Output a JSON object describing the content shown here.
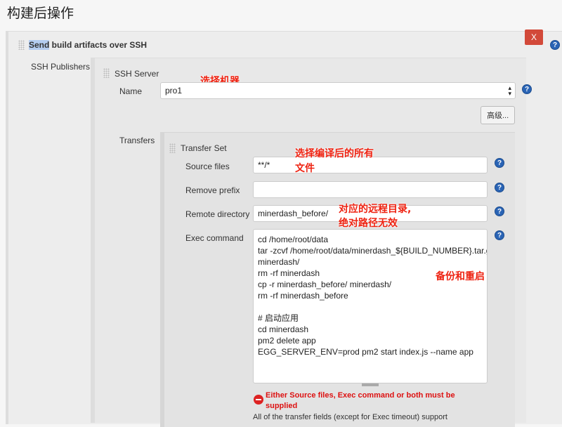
{
  "page_title": "构建后操作",
  "section": {
    "highlight": "Send",
    "title": " build artifacts over SSH",
    "delete_label": "X"
  },
  "publishers_label": "SSH Publishers",
  "server": {
    "title": "SSH Server",
    "name_label": "Name",
    "name_value": "pro1",
    "advanced_label": "高级...",
    "annotation": "选择机器"
  },
  "transfers_label": "Transfers",
  "transfer_set": {
    "title": "Transfer Set",
    "source_label": "Source files",
    "source_value": "**/*",
    "source_note": "选择编译后的所有\n文件",
    "prefix_label": "Remove prefix",
    "prefix_value": "",
    "remote_label": "Remote directory",
    "remote_value": "minerdash_before/",
    "remote_note": "对应的远程目录,\n绝对路径无效",
    "exec_label": "Exec command",
    "exec_value": "cd /home/root/data\ntar -zcvf /home/root/data/minerdash_${BUILD_NUMBER}.tar.gz\nminerdash/\nrm -rf minerdash\ncp -r minerdash_before/ minerdash/\nrm -rf minerdash_before\n\n# 启动应用\ncd minerdash\npm2 delete app\nEGG_SERVER_ENV=prod pm2 start index.js --name app",
    "exec_note": "备份和重启",
    "error": "Either Source files, Exec command or both must be supplied",
    "footer": "All of the transfer fields (except for Exec timeout) support"
  },
  "help_glyph": "?"
}
